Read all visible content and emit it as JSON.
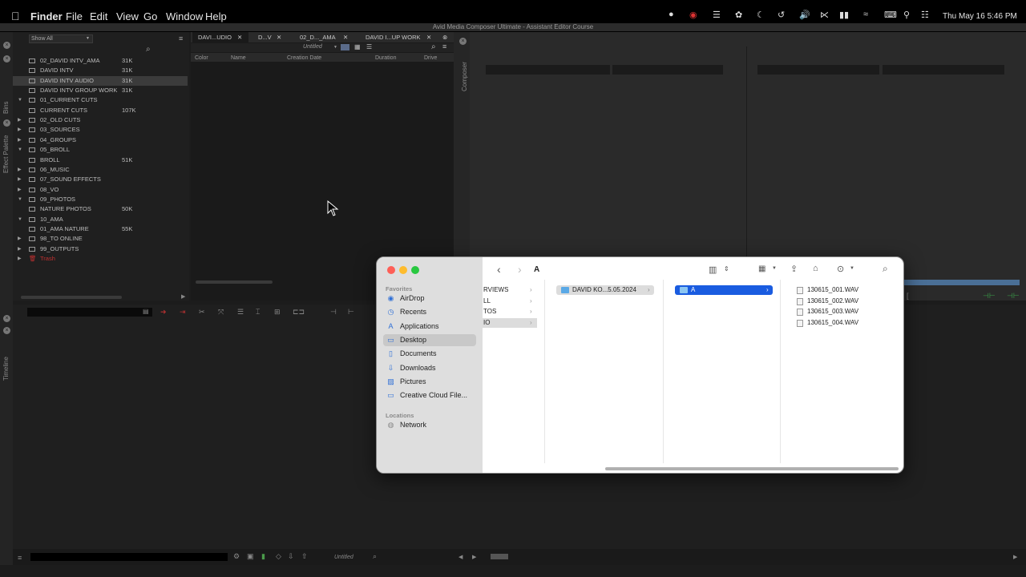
{
  "menubar": {
    "app": "Finder",
    "menus": [
      "File",
      "Edit",
      "View",
      "Go",
      "Window",
      "Help"
    ],
    "clock": "Thu May 16  5:46 PM"
  },
  "avid": {
    "title": "Avid Media Composer Ultimate - Assistant Editor Course",
    "show_all": "Show All",
    "bins_label": "Bins",
    "effect_palette_label": "Effect Palette",
    "composer_label": "Composer",
    "timeline_label": "Timeline",
    "tabs": [
      "DAVI...UDIO",
      "D...V",
      "02_D..._AMA",
      "DAVID I...UP WORK"
    ],
    "view_select": "Untitled",
    "columns": [
      "Color",
      "Name",
      "Creation Date",
      "Duration",
      "Drive"
    ],
    "timeline_select": "Untitled",
    "bins": [
      {
        "label": "02_DAVID INTV_AMA",
        "size": "31K",
        "kind": "bin",
        "indent": 1
      },
      {
        "label": "DAVID INTV",
        "size": "31K",
        "kind": "bin",
        "indent": 1
      },
      {
        "label": "DAVID INTV AUDIO",
        "size": "31K",
        "kind": "bin",
        "indent": 1,
        "selected": true
      },
      {
        "label": "DAVID INTV GROUP WORK",
        "size": "31K",
        "kind": "bin",
        "indent": 1
      },
      {
        "label": "01_CURRENT CUTS",
        "size": "",
        "kind": "folder-open",
        "indent": 0
      },
      {
        "label": "CURRENT CUTS",
        "size": "107K",
        "kind": "bin",
        "indent": 2
      },
      {
        "label": "02_OLD CUTS",
        "size": "",
        "kind": "folder",
        "indent": 0
      },
      {
        "label": "03_SOURCES",
        "size": "",
        "kind": "folder",
        "indent": 0
      },
      {
        "label": "04_GROUPS",
        "size": "",
        "kind": "folder",
        "indent": 0
      },
      {
        "label": "05_BROLL",
        "size": "",
        "kind": "folder-open",
        "indent": 0
      },
      {
        "label": "BROLL",
        "size": "51K",
        "kind": "bin",
        "indent": 2
      },
      {
        "label": "06_MUSIC",
        "size": "",
        "kind": "folder",
        "indent": 0
      },
      {
        "label": "07_SOUND EFFECTS",
        "size": "",
        "kind": "folder",
        "indent": 0
      },
      {
        "label": "08_VO",
        "size": "",
        "kind": "folder",
        "indent": 0
      },
      {
        "label": "09_PHOTOS",
        "size": "",
        "kind": "folder-open",
        "indent": 0
      },
      {
        "label": "NATURE PHOTOS",
        "size": "50K",
        "kind": "bin",
        "indent": 2
      },
      {
        "label": "10_AMA",
        "size": "",
        "kind": "folder-open",
        "indent": 0
      },
      {
        "label": "01_AMA NATURE",
        "size": "55K",
        "kind": "bin",
        "indent": 2
      },
      {
        "label": "98_TO ONLINE",
        "size": "",
        "kind": "folder",
        "indent": 0
      },
      {
        "label": "99_OUTPUTS",
        "size": "",
        "kind": "folder",
        "indent": 0
      },
      {
        "label": "Trash",
        "size": "",
        "kind": "trash",
        "indent": 0
      }
    ]
  },
  "finder": {
    "path_title": "A",
    "favorites_header": "Favorites",
    "favorites": [
      {
        "label": "AirDrop",
        "icon": "airdrop-icon"
      },
      {
        "label": "Recents",
        "icon": "clock-icon"
      },
      {
        "label": "Applications",
        "icon": "applications-icon"
      },
      {
        "label": "Desktop",
        "icon": "desktop-icon",
        "selected": true
      },
      {
        "label": "Documents",
        "icon": "document-icon"
      },
      {
        "label": "Downloads",
        "icon": "download-icon"
      },
      {
        "label": "Pictures",
        "icon": "pictures-icon"
      },
      {
        "label": "Creative Cloud File...",
        "icon": "folder-icon"
      }
    ],
    "locations_header": "Locations",
    "locations": [
      {
        "label": "Network",
        "icon": "network-icon"
      }
    ],
    "col1": [
      "RVIEWS",
      "LL",
      "TOS",
      "IO"
    ],
    "col2": [
      "DAVID KO...5.05.2024"
    ],
    "col3": [
      "A"
    ],
    "col4": [
      "130615_001.WAV",
      "130615_002.WAV",
      "130615_003.WAV",
      "130615_004.WAV"
    ]
  }
}
